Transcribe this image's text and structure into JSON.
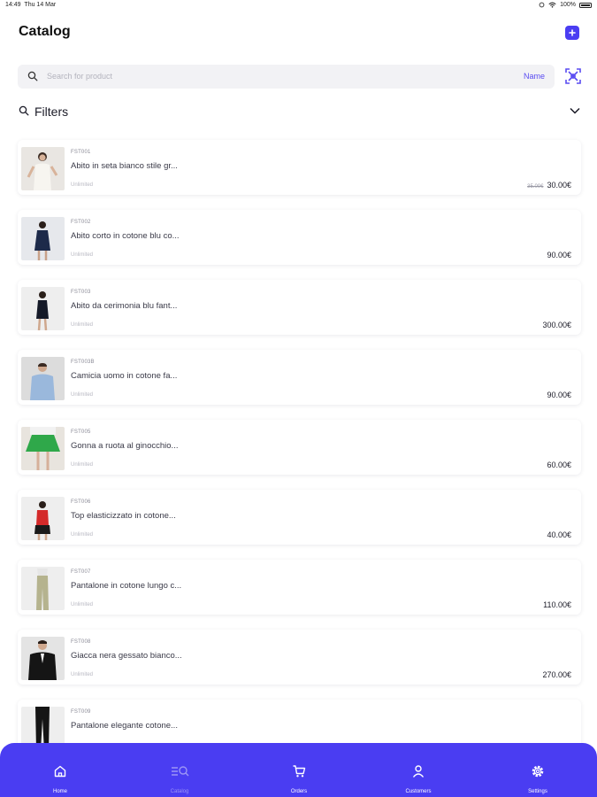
{
  "status_bar": {
    "time": "14:49",
    "date": "Thu 14 Mar",
    "battery": "100%"
  },
  "header": {
    "title": "Catalog",
    "add_icon": "plus-icon"
  },
  "search": {
    "placeholder": "Search for product",
    "field": "Name",
    "scan_icon": "scan-icon"
  },
  "filters": {
    "label": "Filters",
    "icon": "search-icon",
    "chevron": "chevron-down-icon"
  },
  "products": [
    {
      "sku": "FST001",
      "name": "Abito in seta bianco stile gr...",
      "tag": "Unlimited",
      "old_price": "35.00€",
      "price": "30.00€"
    },
    {
      "sku": "FST002",
      "name": "Abito corto in cotone blu co...",
      "tag": "Unlimited",
      "old_price": "",
      "price": "90.00€"
    },
    {
      "sku": "FST003",
      "name": "Abito da cerimonia blu fant...",
      "tag": "Unlimited",
      "old_price": "",
      "price": "300.00€"
    },
    {
      "sku": "FST003B",
      "name": "Camicia uomo in cotone fa...",
      "tag": "Unlimited",
      "old_price": "",
      "price": "90.00€"
    },
    {
      "sku": "FST005",
      "name": "Gonna a ruota al ginocchio...",
      "tag": "Unlimited",
      "old_price": "",
      "price": "60.00€"
    },
    {
      "sku": "FST006",
      "name": "Top elasticizzato in cotone...",
      "tag": "Unlimited",
      "old_price": "",
      "price": "40.00€"
    },
    {
      "sku": "FST007",
      "name": "Pantalone in cotone lungo c...",
      "tag": "Unlimited",
      "old_price": "",
      "price": "110.00€"
    },
    {
      "sku": "FST008",
      "name": "Giacca nera gessato bianco...",
      "tag": "Unlimited",
      "old_price": "",
      "price": "270.00€"
    },
    {
      "sku": "FST009",
      "name": "Pantalone elegante cotone...",
      "tag": "",
      "old_price": "",
      "price": ""
    }
  ],
  "tabs": [
    {
      "label": "Home",
      "icon": "home-icon"
    },
    {
      "label": "Catalog",
      "icon": "catalog-icon"
    },
    {
      "label": "Orders",
      "icon": "cart-icon"
    },
    {
      "label": "Customers",
      "icon": "user-icon"
    },
    {
      "label": "Settings",
      "icon": "gear-icon"
    }
  ],
  "colors": {
    "accent": "#4a3df2",
    "background": "#ffffff",
    "search_bg": "#f2f2f5"
  }
}
